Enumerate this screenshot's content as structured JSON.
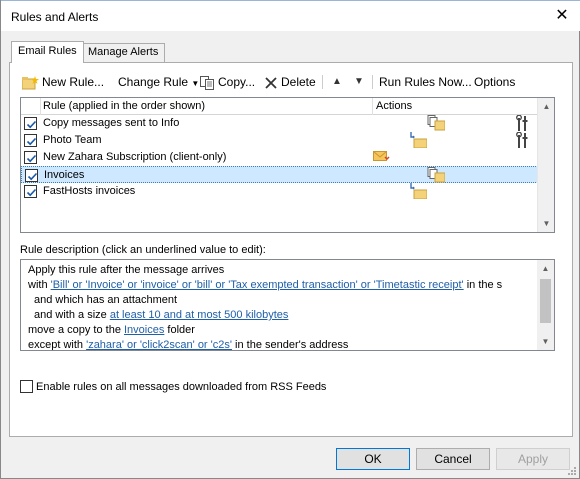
{
  "window": {
    "title": "Rules and Alerts"
  },
  "tabs": [
    {
      "label": "Email Rules",
      "active": true
    },
    {
      "label": "Manage Alerts",
      "active": false
    }
  ],
  "toolbar": {
    "new_rule": "New Rule...",
    "change_rule": "Change Rule",
    "copy": "Copy...",
    "delete": "Delete",
    "run_rules": "Run Rules Now...",
    "options": "Options"
  },
  "rulelist": {
    "col_rule": "Rule (applied in the order shown)",
    "col_actions": "Actions",
    "rows": [
      {
        "label": "Copy messages sent to Info",
        "checked": true,
        "selected": false
      },
      {
        "label": "Photo Team",
        "checked": true,
        "selected": false
      },
      {
        "label": "New Zahara Subscription  (client-only)",
        "checked": true,
        "selected": false
      },
      {
        "label": "Invoices",
        "checked": true,
        "selected": true
      },
      {
        "label": "FastHosts invoices",
        "checked": true,
        "selected": false
      }
    ]
  },
  "description": {
    "label": "Rule description (click an underlined value to edit):",
    "l1": "Apply this rule after the message arrives",
    "l2_pre": "with ",
    "l2_link": "'Bill' or 'Invoice' or 'invoice' or 'bill' or 'Tax exempted transaction' or 'Timetastic receipt'",
    "l2_post": " in the s",
    "l3": "and which has an attachment",
    "l4_pre": "and with a size ",
    "l4_link": "at least 10 and at most 500 kilobytes",
    "l5_pre": "move a copy to the ",
    "l5_link": "Invoices",
    "l5_post": " folder",
    "l6_pre": "except with ",
    "l6_link": "'zahara' or 'click2scan' or 'c2s'",
    "l6_post": " in the sender's address"
  },
  "rss": {
    "label": "Enable rules on all messages downloaded from RSS Feeds",
    "checked": false
  },
  "buttons": {
    "ok": "OK",
    "cancel": "Cancel",
    "apply": "Apply"
  }
}
